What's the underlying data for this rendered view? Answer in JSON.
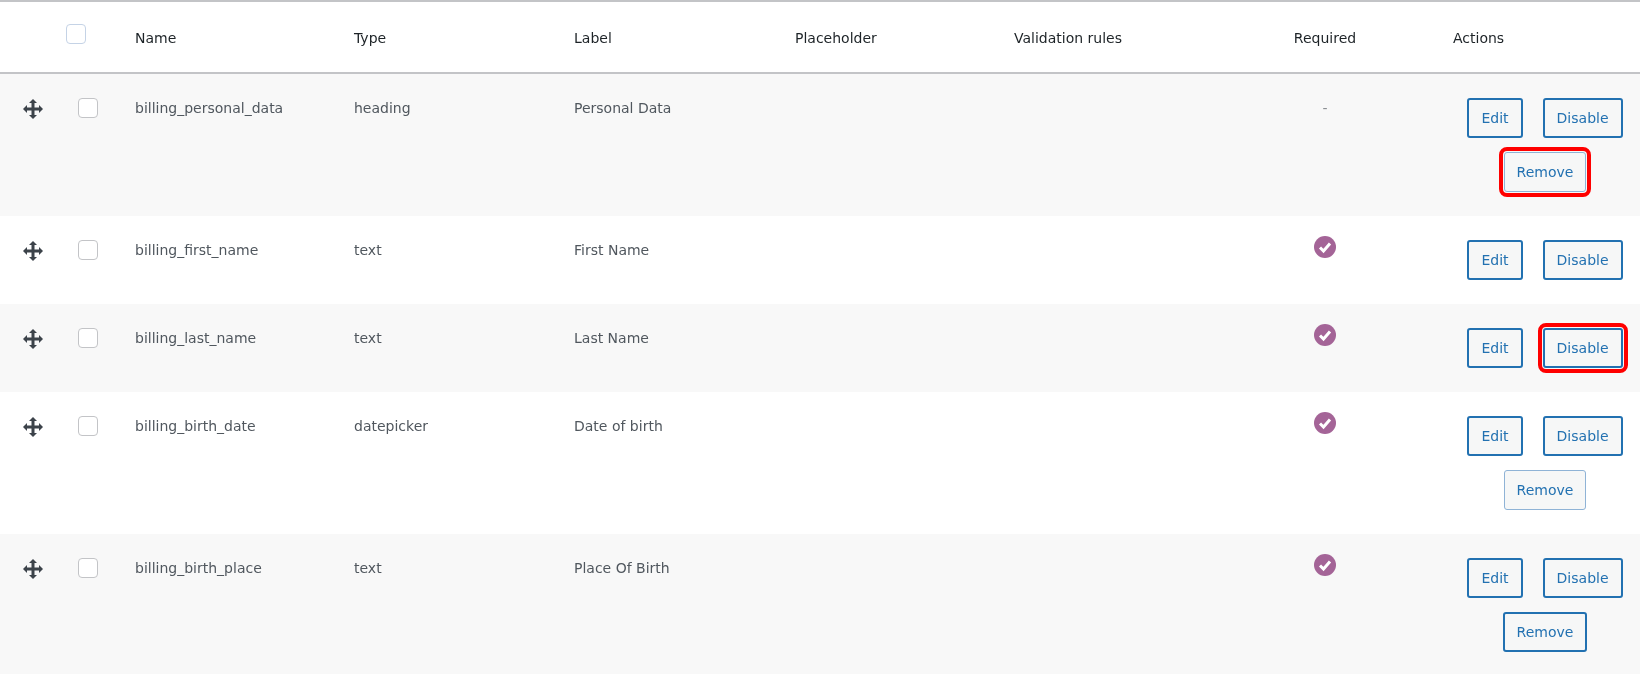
{
  "header": {
    "checked": false,
    "columns": [
      "Name",
      "Type",
      "Label",
      "Placeholder",
      "Validation rules",
      "Required",
      "Actions"
    ]
  },
  "rows": [
    {
      "checked": false,
      "name": "billing_personal_data",
      "type": "heading",
      "label": "Personal Data",
      "required": false,
      "required_text": "-",
      "actions": [
        {
          "label": "Edit",
          "highlighted": false,
          "muted": false
        },
        {
          "label": "Disable",
          "highlighted": false,
          "muted": false
        },
        {
          "label": "Remove",
          "highlighted": true,
          "muted": true
        }
      ]
    },
    {
      "checked": false,
      "name": "billing_first_name",
      "type": "text",
      "label": "First Name",
      "required": true,
      "actions": [
        {
          "label": "Edit",
          "highlighted": false,
          "muted": false
        },
        {
          "label": "Disable",
          "highlighted": false,
          "muted": false
        }
      ]
    },
    {
      "checked": false,
      "name": "billing_last_name",
      "type": "text",
      "label": "Last Name",
      "required": true,
      "actions": [
        {
          "label": "Edit",
          "highlighted": false,
          "muted": false
        },
        {
          "label": "Disable",
          "highlighted": true,
          "muted": false
        }
      ]
    },
    {
      "checked": false,
      "name": "billing_birth_date",
      "type": "datepicker",
      "label": "Date of birth",
      "required": true,
      "actions": [
        {
          "label": "Edit",
          "highlighted": false,
          "muted": false
        },
        {
          "label": "Disable",
          "highlighted": false,
          "muted": false
        },
        {
          "label": "Remove",
          "highlighted": false,
          "muted": true
        }
      ]
    },
    {
      "checked": false,
      "name": "billing_birth_place",
      "type": "text",
      "label": "Place Of Birth",
      "required": true,
      "actions": [
        {
          "label": "Edit",
          "highlighted": false,
          "muted": false
        },
        {
          "label": "Disable",
          "highlighted": false,
          "muted": false
        },
        {
          "label": "Remove",
          "highlighted": false,
          "muted": false
        }
      ]
    }
  ]
}
